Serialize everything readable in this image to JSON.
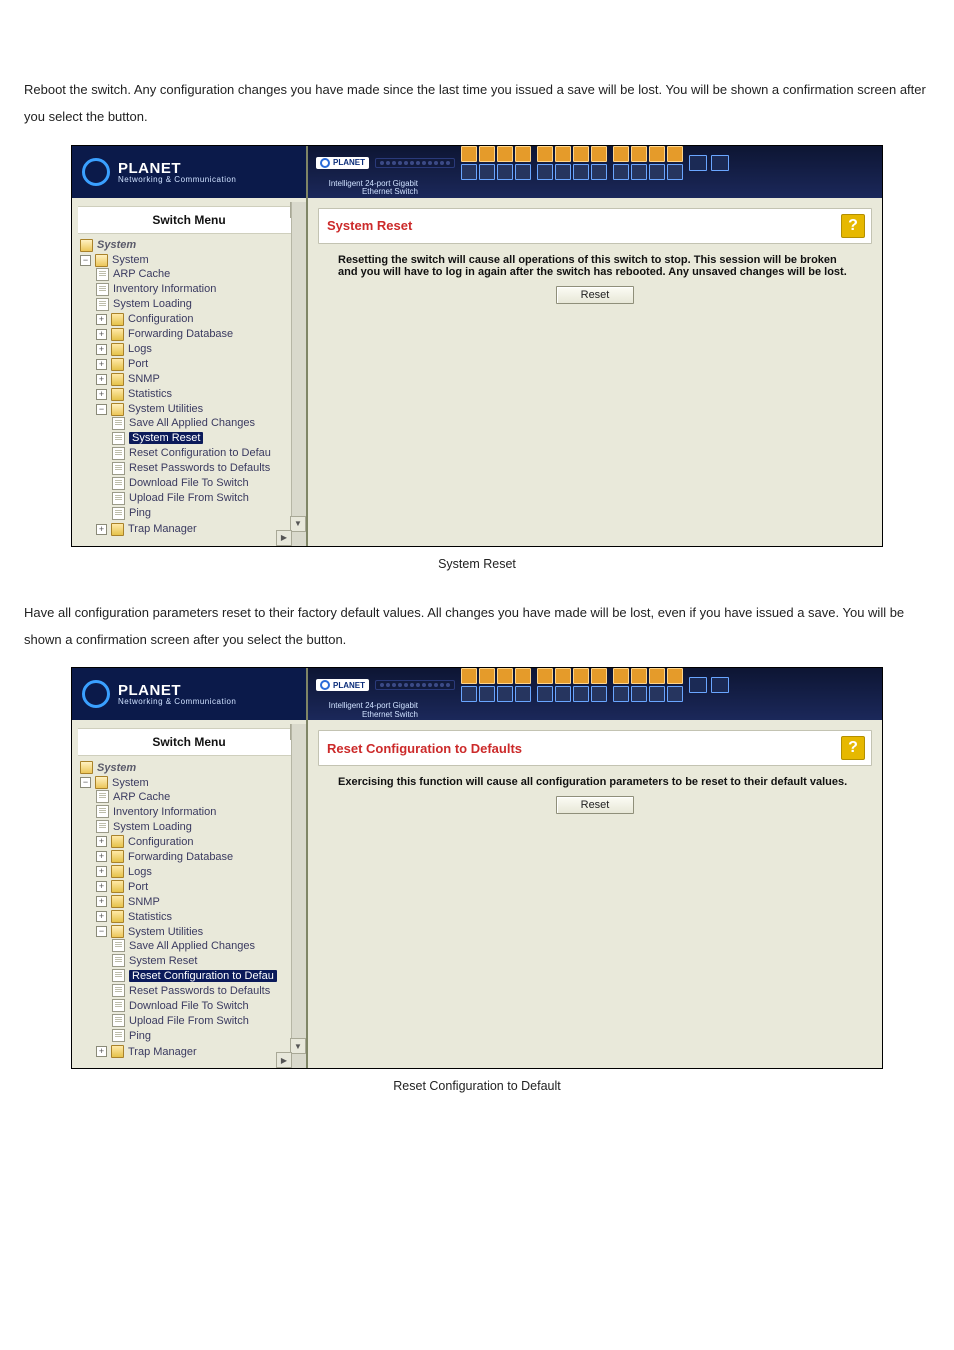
{
  "para1": "Reboot the switch. Any configuration changes you have made since the last time you issued a save will be lost. You will be shown a confirmation screen after you select the button.",
  "para2": "Have all configuration parameters reset to their factory default values. All changes you have made will be lost, even if you have issued a save. You will be shown a confirmation screen after you select the button.",
  "caption1": "System Reset",
  "caption2": "Reset Configuration to Default",
  "brand": {
    "name": "PLANET",
    "tag": "Networking & Communication"
  },
  "topbar": {
    "brand": "PLANET",
    "sub": "Intelligent 24-port Gigabit Ethernet Switch"
  },
  "help_link": "Help",
  "menu_head": "Switch Menu",
  "tree": {
    "root": "System",
    "sys": "System",
    "items": [
      "ARP Cache",
      "Inventory Information",
      "System Loading",
      "Configuration",
      "Forwarding Database",
      "Logs",
      "Port",
      "SNMP",
      "Statistics"
    ],
    "utils": "System Utilities",
    "util_items": [
      "Save All Applied Changes",
      "System Reset",
      "Reset Configuration to Defau",
      "Reset Passwords to Defaults",
      "Download File To Switch",
      "Upload File From Switch",
      "Ping"
    ],
    "trap": "Trap Manager"
  },
  "shot1": {
    "title": "System Reset",
    "desc": "Resetting the switch will cause all operations of this switch to stop. This session will be broken and you will have to log in again after the switch has rebooted. Any unsaved changes will be lost.",
    "btn": "Reset",
    "selected_index": 1
  },
  "shot2": {
    "title": "Reset Configuration to Defaults",
    "desc": "Exercising this function will cause all configuration parameters to be reset to their default values.",
    "btn": "Reset",
    "selected_index": 2
  }
}
